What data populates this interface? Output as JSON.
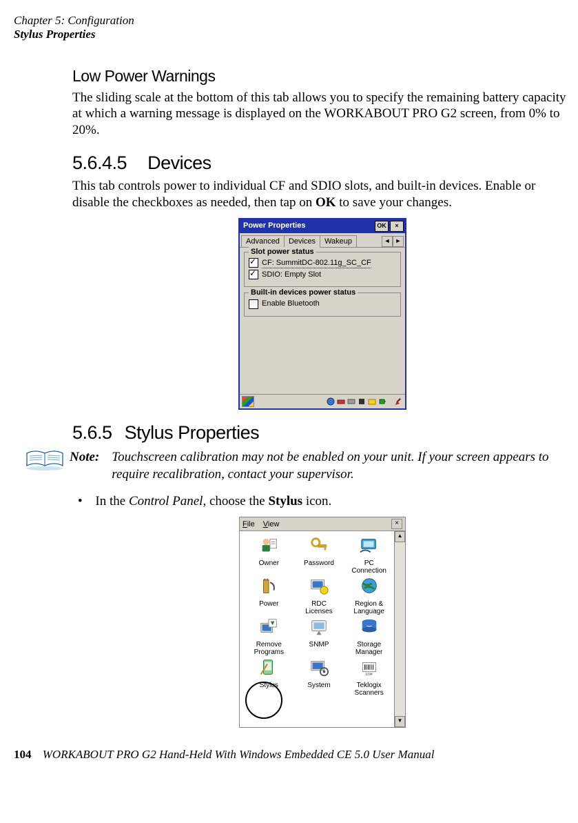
{
  "header": {
    "line1": "Chapter 5: Configuration",
    "line2": "Stylus Properties"
  },
  "s1": {
    "title": "Low Power Warnings",
    "para": "The sliding scale at the bottom of this tab allows you to specify the remaining battery capacity at which a warning message is displayed on the WORKABOUT PRO G2 screen, from 0% to 20%."
  },
  "s2": {
    "num": "5.6.4.5",
    "title": "Devices",
    "para_a": "This tab controls power to individual CF and SDIO slots, and built-in devices. Enable or disable the checkboxes as needed, then tap on ",
    "para_b": "OK",
    "para_c": " to save your changes."
  },
  "win": {
    "title": "Power Properties",
    "ok": "OK",
    "close": "×",
    "tabs": {
      "t1": "Advanced",
      "t2": "Devices",
      "t3": "Wakeup"
    },
    "scroll_left": "◄",
    "scroll_right": "►",
    "g1": {
      "legend": "Slot power status",
      "row1": "CF: SummitDC-802.11g_SC_CF",
      "row2": "SDIO: Empty Slot"
    },
    "g2": {
      "legend": "Built-in devices power status",
      "row1": "Enable Bluetooth"
    }
  },
  "s3": {
    "num": "5.6.5",
    "title": "Stylus Properties",
    "note_label": "Note:",
    "note_text": "Touchscreen calibration may not be enabled on your unit. If your screen appears to require recalibration, contact your supervisor.",
    "bullet_a": "In the ",
    "bullet_b": "Control Panel",
    "bullet_c": ", choose the ",
    "bullet_d": "Stylus",
    "bullet_e": " icon."
  },
  "cp": {
    "menu_file": "File",
    "menu_view": "View",
    "close": "×",
    "up": "▲",
    "down": "▼",
    "items": {
      "i0": "Owner",
      "i1": "Password",
      "i2a": "PC",
      "i2b": "Connection",
      "i3": "Power",
      "i4a": "RDC",
      "i4b": "Licenses",
      "i5a": "Region &",
      "i5b": "Language",
      "i6a": "Remove",
      "i6b": "Programs",
      "i7": "SNMP",
      "i8a": "Storage",
      "i8b": "Manager",
      "i9": "Stylus",
      "i10": "System",
      "i11a": "Teklogix",
      "i11b": "Scanners"
    }
  },
  "footer": {
    "page": "104",
    "text": "WORKABOUT PRO G2 Hand-Held With Windows Embedded CE 5.0 User Manual"
  }
}
